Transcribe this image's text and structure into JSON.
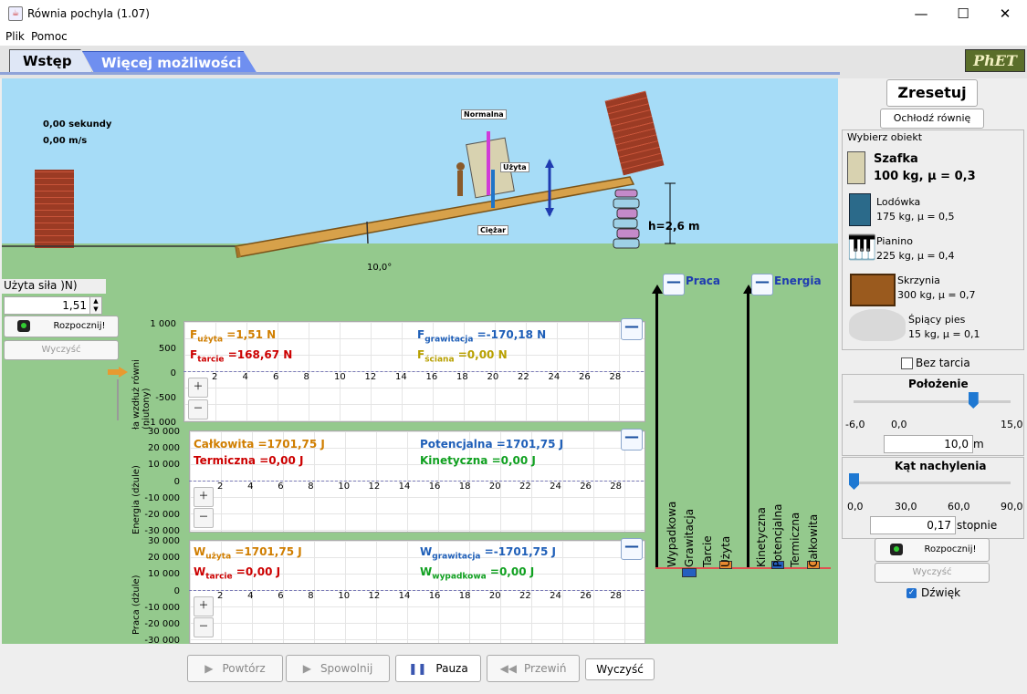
{
  "window": {
    "title": "Równia pochyla (1.07)",
    "minimize": "—",
    "maximize": "☐",
    "close": "✕"
  },
  "menu": {
    "file": "Plik",
    "help": "Pomoc"
  },
  "tabs": [
    {
      "label": "Wstęp"
    },
    {
      "label": "Więcej możliwości"
    }
  ],
  "logo": "PhET",
  "scene": {
    "time": "0,00 sekundy",
    "speed": "0,00 m/s",
    "angle_label": "10,0°",
    "height_label": "h=2,6 m",
    "vector_labels": {
      "normal": "Normalna",
      "applied": "Użyta",
      "weight": "Ciężar"
    }
  },
  "applied_force": {
    "label": "Użyta siła )N)",
    "value": "1,51",
    "start_button": "Rozpocznij!",
    "clear_button": "Wyczyść"
  },
  "charts": {
    "x_ticks": [
      "2",
      "4",
      "6",
      "8",
      "10",
      "12",
      "14",
      "16",
      "18",
      "20",
      "22",
      "24",
      "26",
      "28"
    ],
    "force": {
      "ylabel": "ła wzdłuż równi (niutony)",
      "yticks": [
        "1 000",
        "500",
        "0",
        "-500",
        "-1 000"
      ],
      "applied": "F",
      "applied_sub": "użyta",
      "applied_val": "=1,51 N",
      "friction": "F",
      "friction_sub": "tarcie",
      "friction_val": "=168,67 N",
      "gravity": "F",
      "gravity_sub": "grawitacja",
      "gravity_val": "=-170,18 N",
      "wall": "F",
      "wall_sub": "ściana",
      "wall_val": "=0,00 N"
    },
    "energy": {
      "ylabel": "Energia (dżule)",
      "yticks": [
        "30 000",
        "20 000",
        "10 000",
        "0",
        "-10 000",
        "-20 000",
        "-30 000"
      ],
      "total": "Całkowita",
      "total_val": "=1701,75 J",
      "thermal": "Termiczna",
      "thermal_val": "=0,00 J",
      "potential": "Potencjalna",
      "potential_val": "=1701,75 J",
      "kinetic": "Kinetyczna",
      "kinetic_val": "=0,00 J"
    },
    "work": {
      "ylabel": "Praca (dżule)",
      "yticks": [
        "30 000",
        "20 000",
        "10 000",
        "0",
        "-10 000",
        "-20 000",
        "-30 000"
      ],
      "applied": "W",
      "applied_sub": "użyta",
      "applied_val": "=1701,75 J",
      "friction": "W",
      "friction_sub": "tarcie",
      "friction_val": "=0,00 J",
      "gravity": "W",
      "gravity_sub": "grawitacja",
      "gravity_val": "=-1701,75 J",
      "net": "W",
      "net_sub": "wypadkowa",
      "net_val": "=0,00 J"
    }
  },
  "bars": {
    "work_title": "Praca",
    "energy_title": "Energia",
    "work_labels": [
      "Wypadkowa",
      "Grawitacja",
      "Tarcie",
      "Użyta"
    ],
    "energy_labels": [
      "Kinetyczna",
      "Potencjalna",
      "Termiczna",
      "Całkowita"
    ]
  },
  "right": {
    "reset": "Zresetuj",
    "cool": "Ochłodź równię",
    "choose": "Wybierz obiekt",
    "objects": [
      {
        "name": "Szafka",
        "props": "100 kg, μ = 0,3"
      },
      {
        "name": "Lodówka",
        "props": "175 kg, μ = 0,5"
      },
      {
        "name": "Pianino",
        "props": "225 kg, μ = 0,4"
      },
      {
        "name": "Skrzynia",
        "props": "300 kg, μ = 0,7"
      },
      {
        "name": "Śpiący pies",
        "props": "15 kg, μ = 0,1"
      }
    ],
    "no_friction": "Bez tarcia",
    "position": {
      "title": "Położenie",
      "min": "-6,0",
      "mid": "0,0",
      "max": "15,0",
      "value": "10,0",
      "unit": "m",
      "fraction": 0.76
    },
    "angle": {
      "title": "Kąt nachylenia",
      "t0": "0,0",
      "t1": "30,0",
      "t2": "60,0",
      "t3": "90,0",
      "value": "0,17",
      "unit": "stopnie",
      "fraction": 0.0
    },
    "start": "Rozpocznij!",
    "clear": "Wyczyść",
    "sound": "Dźwięk"
  },
  "playback": {
    "replay": "Powtórz",
    "slow": "Spowolnij",
    "pause": "Pauza",
    "rewind": "Przewiń",
    "clear": "Wyczyść"
  },
  "colors": {
    "sky": "#a6dcf7",
    "ground": "#94c98d",
    "applied": "#d07e00",
    "friction": "#cc0000",
    "gravity": "#1f5fb8",
    "wall": "#b8a000",
    "kinetic": "#10a020"
  }
}
